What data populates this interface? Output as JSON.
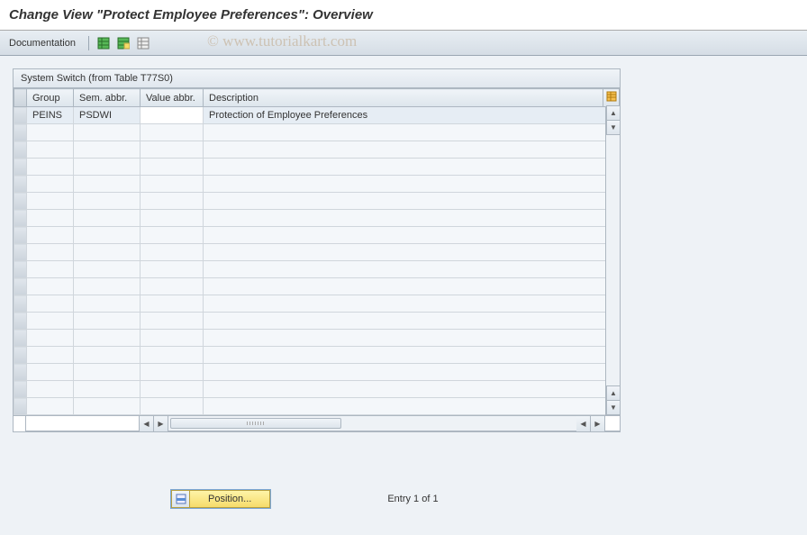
{
  "title": "Change View \"Protect Employee Preferences\": Overview",
  "toolbar": {
    "documentation_label": "Documentation"
  },
  "watermark": "© www.tutorialkart.com",
  "table": {
    "caption": "System Switch (from Table T77S0)",
    "columns": {
      "group": "Group",
      "sem": "Sem. abbr.",
      "value": "Value abbr.",
      "desc": "Description"
    },
    "rows": [
      {
        "group": "PEINS",
        "sem": "PSDWI",
        "value": "",
        "desc": "Protection of Employee Preferences"
      }
    ],
    "empty_row_count": 17
  },
  "footer": {
    "position_label": "Position...",
    "entry_text": "Entry 1 of 1"
  }
}
